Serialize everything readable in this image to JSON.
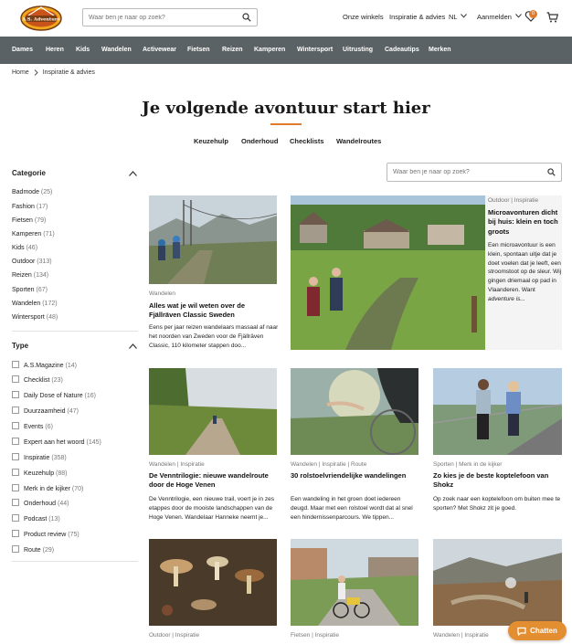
{
  "header": {
    "logo_text": "A.S. Adventure",
    "search_placeholder": "Waar ben je naar op zoek?",
    "nav": {
      "stores": "Onze winkels",
      "inspiration": "Inspiratie & advies",
      "language": "NL",
      "login": "Aanmelden",
      "badge_count": "0"
    }
  },
  "categories": [
    "Dames",
    "Heren",
    "Kids",
    "Wandelen",
    "Activewear",
    "Fietsen",
    "Reizen",
    "Kamperen",
    "Wintersport",
    "Uitrusting",
    "Cadeautips",
    "Merken"
  ],
  "breadcrumb": {
    "home": "Home",
    "current": "Inspiratie & advies"
  },
  "hero": {
    "title": "Je volgende avontuur start hier"
  },
  "tabs": [
    "Keuzehulp",
    "Onderhoud",
    "Checklists",
    "Wandelroutes"
  ],
  "sidebar": {
    "categorie_heading": "Categorie",
    "categorie_items": [
      {
        "label": "Badmode",
        "count": "(25)"
      },
      {
        "label": "Fashion",
        "count": "(17)"
      },
      {
        "label": "Fietsen",
        "count": "(79)"
      },
      {
        "label": "Kamperen",
        "count": "(71)"
      },
      {
        "label": "Kids",
        "count": "(46)"
      },
      {
        "label": "Outdoor",
        "count": "(313)"
      },
      {
        "label": "Reizen",
        "count": "(134)"
      },
      {
        "label": "Sporten",
        "count": "(67)"
      },
      {
        "label": "Wandelen",
        "count": "(172)"
      },
      {
        "label": "Wintersport",
        "count": "(48)"
      }
    ],
    "type_heading": "Type",
    "type_items": [
      {
        "label": "A.S.Magazine",
        "count": "(14)"
      },
      {
        "label": "Checklist",
        "count": "(23)"
      },
      {
        "label": "Daily Dose of Nature",
        "count": "(16)"
      },
      {
        "label": "Duurzaamheid",
        "count": "(47)"
      },
      {
        "label": "Events",
        "count": "(6)"
      },
      {
        "label": "Expert aan het woord",
        "count": "(145)"
      },
      {
        "label": "Inspiratie",
        "count": "(358)"
      },
      {
        "label": "Keuzehulp",
        "count": "(88)"
      },
      {
        "label": "Merk in de kijker",
        "count": "(70)"
      },
      {
        "label": "Onderhoud",
        "count": "(44)"
      },
      {
        "label": "Podcast",
        "count": "(13)"
      },
      {
        "label": "Product review",
        "count": "(75)"
      },
      {
        "label": "Route",
        "count": "(29)"
      }
    ]
  },
  "content_search_placeholder": "Waar ben je naar op zoek?",
  "articles": [
    {
      "meta": "Wandelen",
      "title": "Alles wat je wil weten over de Fjällräven Classic Sweden",
      "text": "Eens per jaar reizen wandelaars massaal af naar het noorden van Zweden voor de Fjällräven Classic, 110 kilometer stappen doo..."
    },
    {
      "meta": "Outdoor | Inspiratie",
      "title": "Microavonturen dicht bij huis: klein en toch groots",
      "text": "Een microavontuur is een klein, spontaan uitje dat je doet voelen dat je leeft, een stroomstoot op de sleur. Wij gingen driemaal op pad in Vlaanderen. Want",
      "text_em": "adventure is..."
    },
    {
      "meta": "Wandelen | Inspiratie",
      "title": "De Venntrilogie: nieuwe wandelroute door de Hoge Venen",
      "text": "De Venntrilogie, een nieuwe trail, voert je in zes etappes door de mooiste landschappen van de Hoge Venen. Wandelaar Hanneke neemt je..."
    },
    {
      "meta": "Wandelen | Inspiratie | Route",
      "title": "30 rolstoelvriendelijke wandelingen",
      "text": "Een wandeling in het groen doet iedereen deugd. Maar met een rolstoel wordt dat al snel een hindernissenparcours. We tippen..."
    },
    {
      "meta": "Sporten | Merk in de kijker",
      "title": "Zo kies je de beste koptelefoon van Shokz",
      "text": "Op zoek naar een koptelefoon om buiten mee te sporten? Met Shokz zit je goed."
    },
    {
      "meta": "Outdoor | Inspiratie"
    },
    {
      "meta": "Fietsen | Inspiratie"
    },
    {
      "meta": "Wandelen | Inspiratie"
    }
  ],
  "chat": {
    "label": "Chatten"
  },
  "colors": {
    "accent": "#e07b2c",
    "catbar": "#5b6265"
  }
}
